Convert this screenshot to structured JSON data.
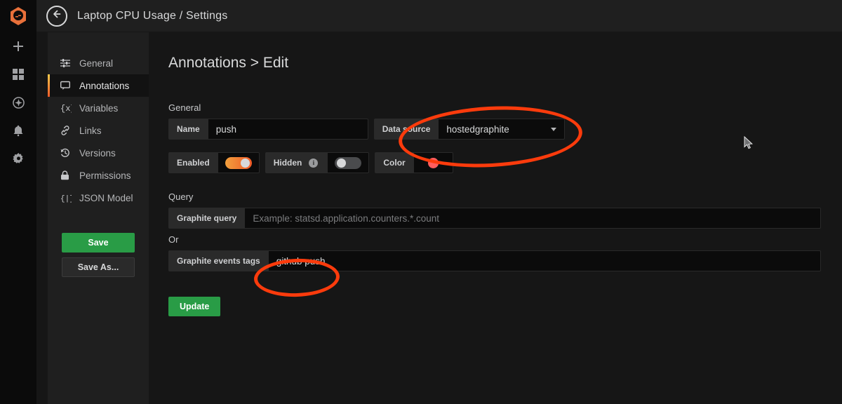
{
  "brand": {
    "logo_icon": "grafana-logo-icon"
  },
  "nav_rail": {
    "items": [
      {
        "icon": "plus-icon",
        "name": "create"
      },
      {
        "icon": "dashboards-icon",
        "name": "dashboards"
      },
      {
        "icon": "compass-icon",
        "name": "explore"
      },
      {
        "icon": "bell-icon",
        "name": "alerting"
      },
      {
        "icon": "gear-icon",
        "name": "configuration"
      }
    ]
  },
  "header": {
    "back_icon": "arrow-left-icon",
    "title": "Laptop CPU Usage / Settings"
  },
  "settings_sidebar": {
    "items": [
      {
        "label": "General",
        "icon": "sliders-icon",
        "active": false
      },
      {
        "label": "Annotations",
        "icon": "comment-icon",
        "active": true
      },
      {
        "label": "Variables",
        "icon": "variable-icon",
        "active": false
      },
      {
        "label": "Links",
        "icon": "link-icon",
        "active": false
      },
      {
        "label": "Versions",
        "icon": "history-icon",
        "active": false
      },
      {
        "label": "Permissions",
        "icon": "lock-icon",
        "active": false
      },
      {
        "label": "JSON Model",
        "icon": "brackets-icon",
        "active": false
      }
    ],
    "save_label": "Save",
    "save_as_label": "Save As..."
  },
  "main": {
    "title": "Annotations > Edit",
    "general_section_label": "General",
    "name_label": "Name",
    "name_value": "push",
    "data_source_label": "Data source",
    "data_source_value": "hostedgraphite",
    "enabled_label": "Enabled",
    "enabled_state": "on",
    "hidden_label": "Hidden",
    "hidden_state": "off",
    "hidden_info_glyph": "i",
    "color_label": "Color",
    "color_value": "#ff5d5d",
    "query_section_label": "Query",
    "graphite_query_label": "Graphite query",
    "graphite_query_placeholder": "Example: statsd.application.counters.*.count",
    "or_label": "Or",
    "graphite_events_tags_label": "Graphite events tags",
    "graphite_events_tags_value": "github push",
    "update_label": "Update"
  },
  "annotations_overlay": {
    "color": "#fb3b0c",
    "marks": [
      {
        "name": "data-source-highlight",
        "shape": "ellipse"
      },
      {
        "name": "events-tags-highlight",
        "shape": "ellipse"
      }
    ]
  },
  "theme": {
    "accent_orange": "#f05a28",
    "green": "#299c46",
    "panel_bg": "#1f1f1f",
    "content_bg": "#161616",
    "input_bg": "#0b0b0b"
  }
}
